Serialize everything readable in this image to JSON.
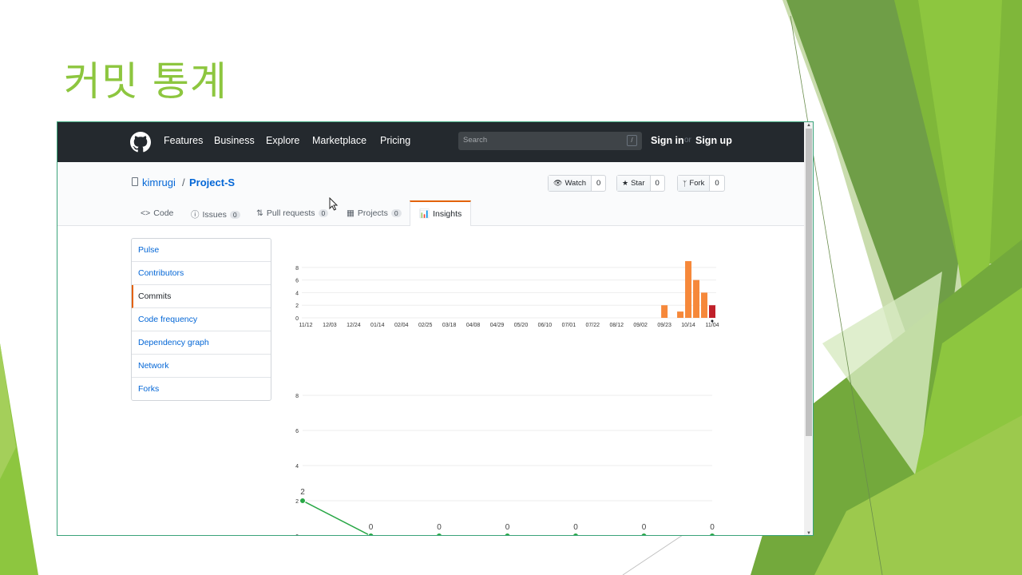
{
  "slide": {
    "title": "커밋 통계"
  },
  "header": {
    "nav": [
      "Features",
      "Business",
      "Explore",
      "Marketplace",
      "Pricing"
    ],
    "search_placeholder": "Search",
    "search_key": "/",
    "sign_in": "Sign in",
    "or": "or",
    "sign_up": "Sign up",
    "logo": "github-octocat-icon"
  },
  "repo": {
    "owner": "kimrugi",
    "separator": "/",
    "name": "Project-S",
    "actions": [
      {
        "label": "Watch",
        "count": "0",
        "icon": "eye-icon"
      },
      {
        "label": "Star",
        "count": "0",
        "icon": "star-icon"
      },
      {
        "label": "Fork",
        "count": "0",
        "icon": "fork-icon"
      }
    ],
    "tabs": [
      {
        "label": "Code",
        "count": ""
      },
      {
        "label": "Issues",
        "count": "0"
      },
      {
        "label": "Pull requests",
        "count": "0"
      },
      {
        "label": "Projects",
        "count": "0"
      },
      {
        "label": "Insights",
        "count": ""
      }
    ]
  },
  "sidebar": {
    "items": [
      "Pulse",
      "Contributors",
      "Commits",
      "Code frequency",
      "Dependency graph",
      "Network",
      "Forks"
    ],
    "selected": "Commits"
  },
  "colors": {
    "accent": "#8dc63f",
    "bar": "#f6883a",
    "bar_selected": "#c0202a",
    "line": "#28a745",
    "link": "#0366d6",
    "header_bg": "#24292e"
  },
  "chart_data": [
    {
      "type": "bar",
      "categories": [
        "11/12",
        "11/19",
        "11/26",
        "12/03",
        "12/10",
        "12/17",
        "12/24",
        "12/31",
        "01/07",
        "01/14",
        "01/21",
        "01/28",
        "02/04",
        "02/11",
        "02/18",
        "02/25",
        "03/04",
        "03/11",
        "03/18",
        "03/25",
        "04/01",
        "04/08",
        "04/15",
        "04/22",
        "04/29",
        "05/06",
        "05/13",
        "05/20",
        "05/27",
        "06/03",
        "06/10",
        "06/17",
        "06/24",
        "07/01",
        "07/08",
        "07/15",
        "07/22",
        "07/29",
        "08/05",
        "08/12",
        "08/19",
        "08/26",
        "09/02",
        "09/09",
        "09/16",
        "09/23",
        "09/30",
        "10/07",
        "10/14",
        "10/21",
        "10/28",
        "11/04"
      ],
      "tick_labels": [
        "11/12",
        "12/03",
        "12/24",
        "01/14",
        "02/04",
        "02/25",
        "03/18",
        "04/08",
        "04/29",
        "05/20",
        "06/10",
        "07/01",
        "07/22",
        "08/12",
        "09/02",
        "09/23",
        "10/14",
        "11/04"
      ],
      "values": [
        0,
        0,
        0,
        0,
        0,
        0,
        0,
        0,
        0,
        0,
        0,
        0,
        0,
        0,
        0,
        0,
        0,
        0,
        0,
        0,
        0,
        0,
        0,
        0,
        0,
        0,
        0,
        0,
        0,
        0,
        0,
        0,
        0,
        0,
        0,
        0,
        0,
        0,
        0,
        0,
        0,
        0,
        0,
        0,
        0,
        2,
        0,
        1,
        9,
        6,
        4,
        2
      ],
      "selected_index": 51,
      "yticks": [
        0,
        2,
        4,
        6,
        8
      ],
      "ylim": [
        0,
        9
      ]
    },
    {
      "type": "line",
      "x": [
        0,
        1,
        2,
        3,
        4,
        5,
        6
      ],
      "values": [
        2,
        0,
        0,
        0,
        0,
        0,
        0
      ],
      "labels": [
        "2",
        "0",
        "0",
        "0",
        "0",
        "0",
        "0"
      ],
      "yticks": [
        0,
        2,
        4,
        6,
        8
      ],
      "ylim": [
        0,
        9
      ]
    }
  ]
}
